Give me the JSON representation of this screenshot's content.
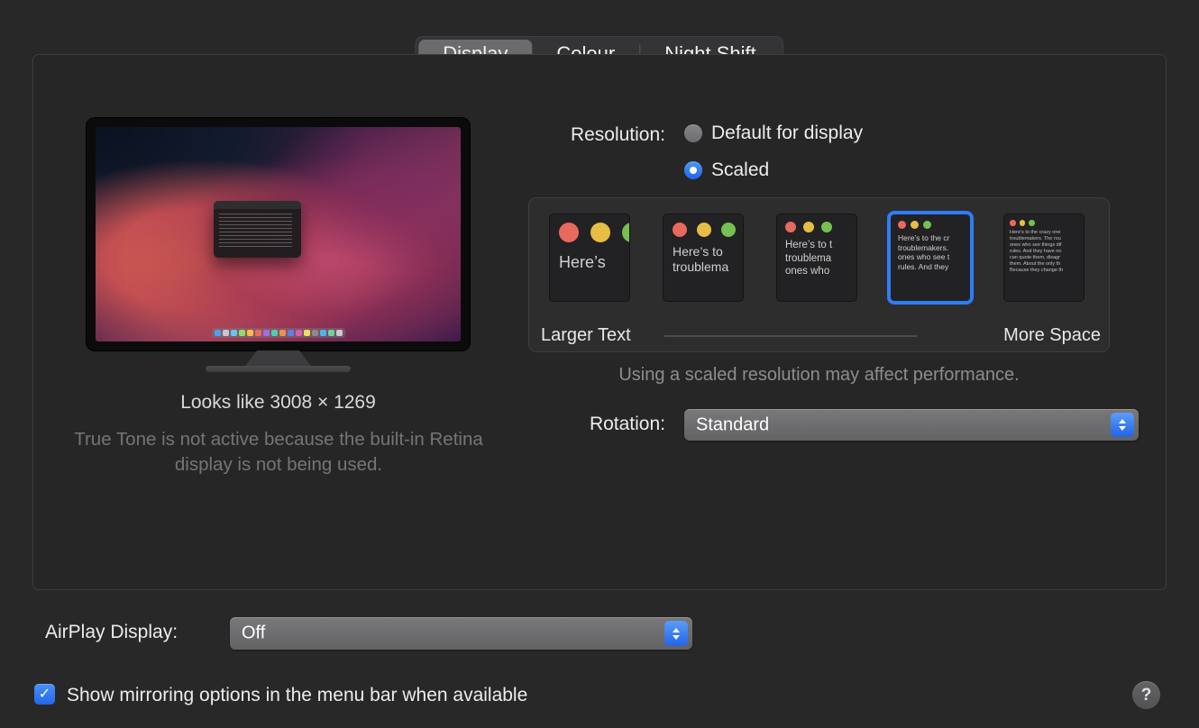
{
  "accent": "#2f7cf6",
  "tabs": [
    {
      "label": "Display",
      "selected": true
    },
    {
      "label": "Colour",
      "selected": false
    },
    {
      "label": "Night Shift",
      "selected": false
    }
  ],
  "display": {
    "looks_like": "Looks like 3008 × 1269",
    "true_tone_note": "True Tone is not active because the built-in Retina display is not being used."
  },
  "resolution": {
    "label": "Resolution:",
    "options": [
      {
        "label": "Default for display",
        "selected": false
      },
      {
        "label": "Scaled",
        "selected": true
      }
    ],
    "scale_options": [
      {
        "selected": false,
        "lines": [
          "Here’s"
        ]
      },
      {
        "selected": false,
        "lines": [
          "Here’s to",
          "troublema"
        ]
      },
      {
        "selected": false,
        "lines": [
          "Here’s to t",
          "troublema",
          "ones who"
        ]
      },
      {
        "selected": true,
        "lines": [
          "Here’s to the cr",
          "troublemakers.",
          "ones who see t",
          "rules. And they"
        ]
      },
      {
        "selected": false,
        "lines": [
          "Here’s to the crazy one",
          "troublemakers. The rou",
          "ones who see things dif",
          "rules. And they have no",
          "can quote them, disagr",
          "them. About the only th",
          "Because they change th"
        ]
      }
    ],
    "larger_text": "Larger Text",
    "more_space": "More Space",
    "note": "Using a scaled resolution may affect performance."
  },
  "rotation": {
    "label": "Rotation:",
    "value": "Standard"
  },
  "airplay": {
    "label": "AirPlay Display:",
    "value": "Off"
  },
  "mirroring": {
    "label": "Show mirroring options in the menu bar when available",
    "checked": true,
    "checkmark": "✓"
  },
  "help": {
    "label": "?"
  }
}
